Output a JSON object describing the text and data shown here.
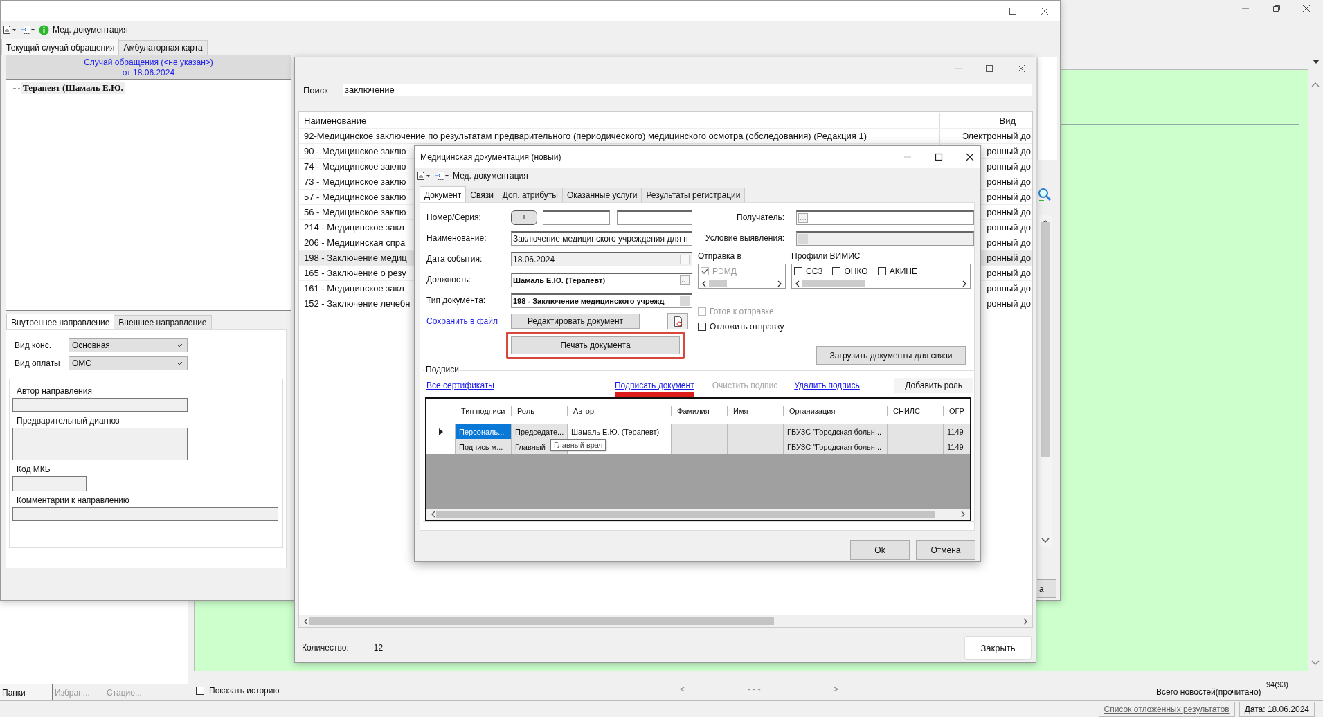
{
  "desktop": {
    "bottom_tabs": [
      {
        "label": "Папки",
        "selected": true
      },
      {
        "label": "Избран...",
        "selected": false
      },
      {
        "label": "Стацио...",
        "selected": false
      }
    ],
    "show_history": {
      "label": "Показать историю",
      "checked": false
    },
    "pager": {
      "prev": "<",
      "range": "- - -",
      "next": ">"
    },
    "news": {
      "label": "Всего новостей(прочитано)",
      "count": "94(93)"
    },
    "status_bar": {
      "deferred_link": "Список отложенных результатов",
      "date": "Дата: 18.06.2024"
    }
  },
  "main_window": {
    "toolbar_title": "Мед. документация",
    "tabs": [
      {
        "label": "Текущий случай обращения",
        "selected": true
      },
      {
        "label": "Амбулаторная карта",
        "selected": false
      }
    ],
    "case_header": {
      "title": "Случай обращения (<не указан>)",
      "date": "от 18.06.2024"
    },
    "tree": [
      {
        "label": "Терапевт (Шамаль Е.Ю.",
        "selected": true
      }
    ],
    "referral_tabs": [
      {
        "label": "Внутреннее направление",
        "selected": true
      },
      {
        "label": "Внешнее направление",
        "selected": false
      }
    ],
    "selects": [
      {
        "label": "Вид конс.",
        "value": "Основная"
      },
      {
        "label": "Вид оплаты",
        "value": "ОМС"
      }
    ],
    "fields": [
      {
        "label": "Автор направления",
        "kind": "line"
      },
      {
        "label": "Предварительный диагноз",
        "kind": "area"
      },
      {
        "label": "Код МКБ",
        "kind": "short"
      },
      {
        "label": "Комментарии к направлению",
        "kind": "wide"
      }
    ],
    "side_button": "а"
  },
  "search_window": {
    "search_label": "Поиск",
    "search_value": "заключение",
    "columns": [
      "Наименование",
      "Вид"
    ],
    "rows": [
      {
        "name": "92-Медицинское заключение по результатам предварительного (периодического) медицинского осмотра (обследования) (Редакция 1)",
        "type": "Электронный до",
        "selected": false
      },
      {
        "name": "90 - Медицинское заклю",
        "type": "ронный до",
        "selected": false
      },
      {
        "name": "74 - Медицинское заклю",
        "type": "ронный до",
        "selected": false
      },
      {
        "name": "73 - Медицинское заклю",
        "type": "ронный до",
        "selected": false
      },
      {
        "name": "57 - Медицинское заклю",
        "type": "ронный до",
        "selected": false
      },
      {
        "name": "56 - Медицинское заклю",
        "type": "ронный до",
        "selected": false
      },
      {
        "name": "214 - Медицинское закл",
        "type": "ронный до",
        "selected": false
      },
      {
        "name": "206 - Медицинская спра",
        "type": "ронный до",
        "selected": false
      },
      {
        "name": "198 - Заключение медиц",
        "type": "ронный до",
        "selected": true
      },
      {
        "name": "165 - Заключение о резу",
        "type": "ронный до",
        "selected": false
      },
      {
        "name": "161 - Медицинское закл",
        "type": "ронный до",
        "selected": false
      },
      {
        "name": "152 - Заключение лечебн",
        "type": "ронный до",
        "selected": false
      }
    ],
    "count_label": "Количество:",
    "count": "12",
    "close_button": "Закрыть"
  },
  "dialog": {
    "title": "Медицинская документация (новый)",
    "toolbar_title": "Мед. документация",
    "tabs": [
      {
        "label": "Документ",
        "selected": true
      },
      {
        "label": "Связи",
        "selected": false
      },
      {
        "label": "Доп. атрибуты",
        "selected": false
      },
      {
        "label": "Оказанные услуги",
        "selected": false
      },
      {
        "label": "Результаты регистрации",
        "selected": false
      }
    ],
    "number_label": "Номер/Серия:",
    "add_button": "+",
    "name_label": "Наименование:",
    "name_value": "Заключение медицинского учреждения для п",
    "date_label": "Дата события:",
    "date_value": "18.06.2024",
    "position_label": "Должность:",
    "position_value": "Шамаль Е.Ю. (Терапевт)",
    "doc_type_label": "Тип документа:",
    "doc_type_value": "198 - Заключение медицинского учрежд",
    "recipient_label": "Получатель:",
    "condition_label": "Условие выявления:",
    "send_to": {
      "title": "Отправка в",
      "options": [
        {
          "label": "РЭМД",
          "checked": true,
          "disabled": true
        }
      ]
    },
    "vimis": {
      "title": "Профили ВИМИС",
      "options": [
        {
          "label": "ССЗ",
          "checked": false,
          "disabled": false
        },
        {
          "label": "ОНКО",
          "checked": false,
          "disabled": false
        },
        {
          "label": "АКИНЕ",
          "checked": false,
          "disabled": false
        }
      ]
    },
    "save_link": "Сохранить в файл",
    "edit_button": "Редактировать документ",
    "print_button": {
      "label": "Печать документа",
      "highlighted": true
    },
    "ready": {
      "label": "Готов к отправке",
      "checked": false,
      "disabled": true
    },
    "postpone": {
      "label": "Отложить отправку",
      "checked": false,
      "disabled": false
    },
    "load_button": "Загрузить документы для связи",
    "signatures": {
      "title": "Подписи",
      "actions": [
        {
          "label": "Все сертификаты",
          "kind": "link",
          "highlighted": false
        },
        {
          "label": "Подписать документ",
          "kind": "link",
          "highlighted": true
        },
        {
          "label": "Очистить подпис",
          "kind": "disabled",
          "highlighted": false
        },
        {
          "label": "Удалить подпись",
          "kind": "link",
          "highlighted": false
        },
        {
          "label": "Добавить роль",
          "kind": "button",
          "highlighted": false
        }
      ],
      "columns": [
        {
          "label": "Тип подписи",
          "readonly": true
        },
        {
          "label": "Роль",
          "readonly": true
        },
        {
          "label": "Автор",
          "readonly": false
        },
        {
          "label": "Фамилия",
          "readonly": true
        },
        {
          "label": "Имя",
          "readonly": true
        },
        {
          "label": "Организация",
          "readonly": true
        },
        {
          "label": "СНИЛС",
          "readonly": true
        },
        {
          "label": "ОГР",
          "readonly": true
        }
      ],
      "rows": [
        {
          "current": true,
          "selected": true,
          "cells": [
            "Персональ...",
            "Председате...",
            "Шамаль Е.Ю. (Терапевт)",
            "",
            "",
            "ГБУЗС \"Городская больн...",
            "",
            "1149"
          ]
        },
        {
          "current": false,
          "selected": false,
          "cells": [
            "Подпись м...",
            "Главный",
            "",
            "",
            "",
            "ГБУЗС \"Городская больн...",
            "",
            "1149"
          ]
        }
      ],
      "tooltip": "Главный врач"
    },
    "ok_button": "Ok",
    "cancel_button": "Отмена"
  }
}
